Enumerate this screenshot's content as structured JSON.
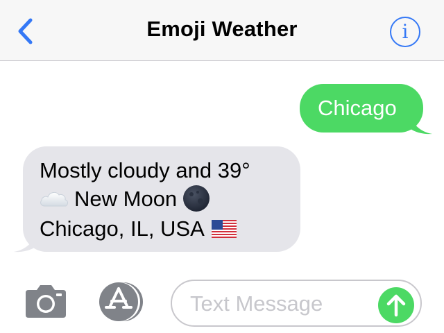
{
  "header": {
    "title": "Emoji Weather",
    "back_icon": "chevron-left-icon",
    "info_icon": "info-icon",
    "info_glyph": "i"
  },
  "messages": [
    {
      "direction": "outgoing",
      "text": "Chicago"
    },
    {
      "direction": "incoming",
      "lines": [
        "Mostly cloudy and 39°",
        "New Moon",
        "Chicago, IL, USA"
      ],
      "emojis": [
        "cloud-emoji",
        "new-moon-emoji",
        "us-flag-emoji"
      ]
    }
  ],
  "composer": {
    "placeholder": "Text Message",
    "value": "",
    "camera_icon": "camera-icon",
    "apps_icon": "app-store-icon",
    "send_icon": "send-arrow-icon"
  },
  "colors": {
    "accent": "#3478f6",
    "outgoing_bubble": "#4cd964",
    "incoming_bubble": "#e5e5ea",
    "header_bg": "#f7f7f7",
    "icon_gray": "#808389"
  }
}
